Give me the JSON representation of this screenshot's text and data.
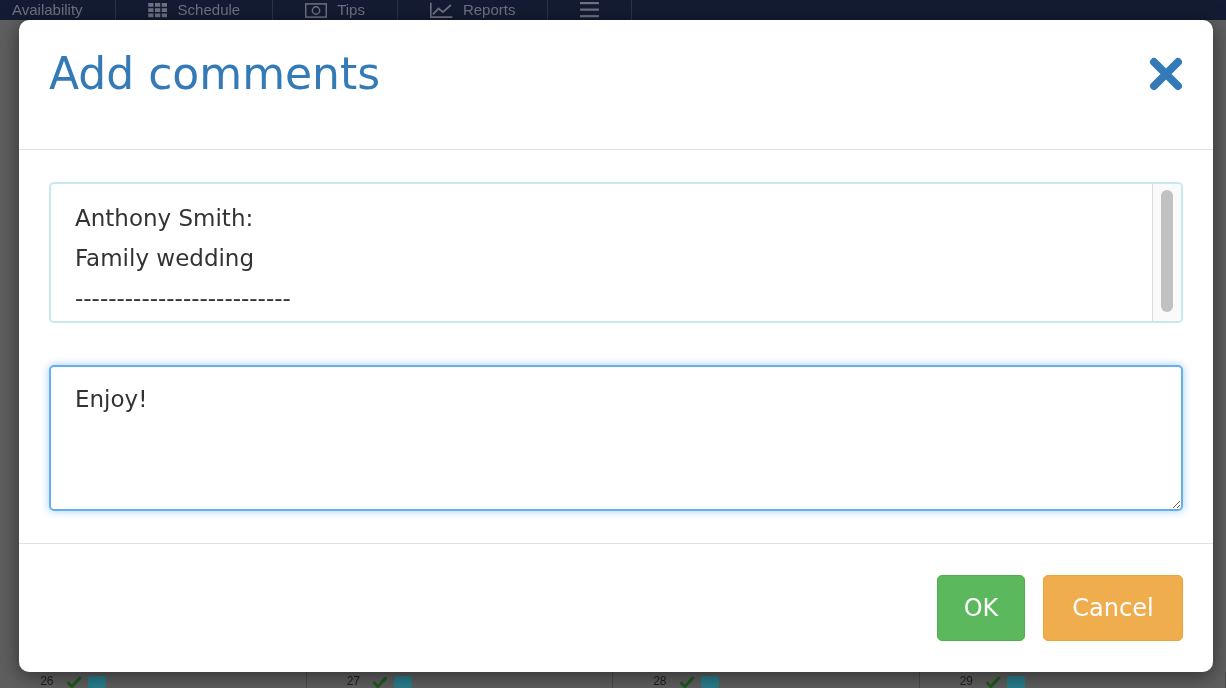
{
  "nav": {
    "items": [
      {
        "label": "Availability",
        "kind": "text"
      },
      {
        "label": "Schedule",
        "kind": "grid"
      },
      {
        "label": "Tips",
        "kind": "money"
      },
      {
        "label": "Reports",
        "kind": "chart"
      },
      {
        "kind": "menu"
      }
    ]
  },
  "calendar": {
    "days": [
      {
        "day": "26",
        "color": "#2a7f8f"
      },
      {
        "day": "27",
        "color": "#2a7f8f"
      },
      {
        "day": "28",
        "color": "#2a7f8f"
      },
      {
        "day": "29",
        "color": "#2a7f8f"
      }
    ]
  },
  "dialog": {
    "title": "Add comments",
    "history": {
      "lines": [
        "Anthony Smith:",
        "Family wedding",
        "--------------------------"
      ]
    },
    "comment": {
      "value": "Enjoy!",
      "focused": true
    },
    "buttons": [
      {
        "label": "OK",
        "kind": "primary"
      },
      {
        "label": "Cancel",
        "kind": "secondary"
      }
    ]
  }
}
